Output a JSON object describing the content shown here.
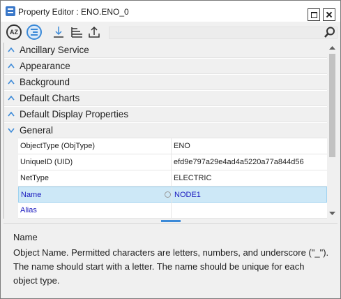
{
  "window": {
    "title": "Property Editor : ENO.ENO_0"
  },
  "toolbar": {
    "sort_label": "AZ",
    "search": {
      "value": "",
      "placeholder": ""
    }
  },
  "categories": [
    {
      "label": "Ancillary Service"
    },
    {
      "label": "Appearance"
    },
    {
      "label": "Background"
    },
    {
      "label": "Default Charts"
    },
    {
      "label": "Default Display Properties"
    },
    {
      "label": "General"
    }
  ],
  "properties": [
    {
      "name": "ObjectType (ObjType)",
      "value": "ENO"
    },
    {
      "name": "UniqueID (UID)",
      "value": "efd9e797a29e4ad4a5220a77a844d56"
    },
    {
      "name": "NetType",
      "value": "ELECTRIC"
    },
    {
      "name": "Name",
      "value": "NODE1"
    },
    {
      "name": "Alias",
      "value": ""
    }
  ],
  "description": {
    "title": "Name",
    "text": "Object Name. Permitted characters are letters, numbers, and underscore (\"_\"). The name should start with a letter. The name should be unique for each object type."
  },
  "colors": {
    "accent": "#3c8ad8",
    "selected_row": "#cde8f7",
    "blue_text": "#1b1bbf"
  }
}
